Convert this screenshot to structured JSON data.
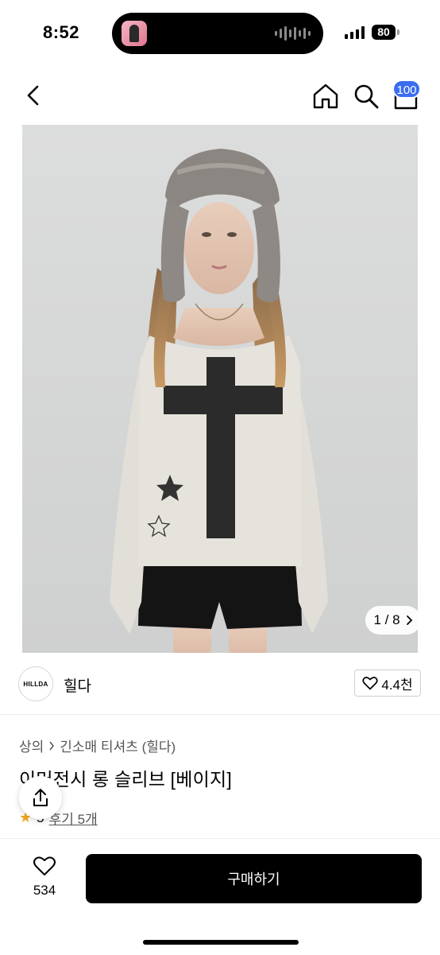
{
  "status_bar": {
    "time": "8:52",
    "battery": "80"
  },
  "nav": {
    "cart_badge": "100"
  },
  "gallery": {
    "counter": "1 / 8"
  },
  "shop": {
    "logo_text": "HILLDA",
    "name": "힐다",
    "likes": "4.4천"
  },
  "product": {
    "breadcrumb": [
      "상의",
      "긴소매 티셔츠 (힐다)"
    ],
    "title": "이머전시 롱 슬리브 [베이지]",
    "rating": "5",
    "reviews_label": "후기 5개"
  },
  "bottom": {
    "wish_count": "534",
    "buy_label": "구매하기"
  },
  "colors": {
    "accent_badge": "#3a6df0",
    "primary_button": "#000000",
    "star": "#f5a623"
  }
}
